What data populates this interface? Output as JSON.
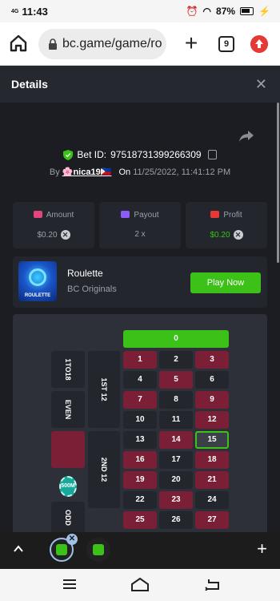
{
  "status_bar": {
    "network": "4G",
    "time": "11:43",
    "battery": "87%"
  },
  "browser": {
    "url": "bc.game/game/ro",
    "tab_count": "9"
  },
  "details": {
    "title": "Details",
    "bet_label": "Bet ID:",
    "bet_id": "97518731399266309",
    "by_label": "By",
    "username": "🌸nica19🇵🇭",
    "on_label": "On",
    "datetime": "11/25/2022, 11:41:12 PM"
  },
  "stats": {
    "amount_label": "Amount",
    "amount_value": "$0.20",
    "payout_label": "Payout",
    "payout_value": "2 x",
    "profit_label": "Profit",
    "profit_value": "$0.20"
  },
  "game": {
    "thumb_caption": "ROULETTE",
    "name": "Roulette",
    "provider": "BC Originals",
    "play_label": "Play Now"
  },
  "board": {
    "zero": "0",
    "rows": [
      [
        "1",
        "2",
        "3"
      ],
      [
        "4",
        "5",
        "6"
      ],
      [
        "7",
        "8",
        "9"
      ],
      [
        "10",
        "11",
        "12"
      ],
      [
        "13",
        "14",
        "15"
      ],
      [
        "16",
        "17",
        "18"
      ],
      [
        "19",
        "20",
        "21"
      ],
      [
        "22",
        "23",
        "24"
      ],
      [
        "25",
        "26",
        "27"
      ]
    ],
    "red_numbers": [
      "1",
      "3",
      "5",
      "7",
      "9",
      "12",
      "14",
      "16",
      "18",
      "19",
      "21",
      "23",
      "25",
      "27"
    ],
    "selected": "15",
    "side_labels": {
      "low": "1TO18",
      "even": "EVEN",
      "first12": "1ST 12",
      "second12": "2ND 12",
      "odd": "ODD"
    },
    "chip_label": "500M"
  },
  "colors": {
    "accent_green": "#3bc117",
    "red_cell": "#7a1f35",
    "panel": "#23262d"
  }
}
